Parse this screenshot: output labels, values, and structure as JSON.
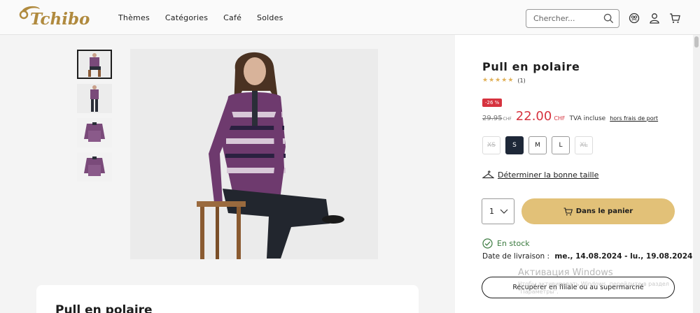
{
  "brand": {
    "name": "Tchibo",
    "color": "#b08a3e"
  },
  "nav": {
    "items": [
      "Thèmes",
      "Catégories",
      "Café",
      "Soldes"
    ]
  },
  "search": {
    "placeholder": "Chercher..."
  },
  "header_icons": [
    "fan-club-icon",
    "account-icon",
    "cart-icon"
  ],
  "gallery": {
    "thumbnails": [
      "thumbnail-1",
      "thumbnail-2",
      "thumbnail-3",
      "thumbnail-4"
    ],
    "active_index": 0
  },
  "product": {
    "title": "Pull en polaire",
    "rating": {
      "stars": 5,
      "count_label": "(1)"
    },
    "discount_badge": "-26 %",
    "old_price": "29.95",
    "old_currency": "CHF",
    "new_price": "22.00",
    "new_currency": "CHF",
    "tva_label": "TVA incluse",
    "shipping_link": "hors frais de port",
    "sizes": [
      {
        "label": "XS",
        "state": "disabled"
      },
      {
        "label": "S",
        "state": "selected"
      },
      {
        "label": "M",
        "state": "available"
      },
      {
        "label": "L",
        "state": "available"
      },
      {
        "label": "XL",
        "state": "disabled"
      }
    ],
    "fit_link": "Déterminer la bonne taille",
    "quantity": "1",
    "add_to_cart": "Dans le panier",
    "stock_status": "En stock",
    "delivery_label": "Date de livraison :",
    "delivery_dates": "me., 14.08.2024 - lu., 19.08.2024",
    "pickup_button": "Récupérer en filiale ou au supermarché"
  },
  "description": {
    "title": "Pull en polaire"
  },
  "os_watermark": {
    "title": "Активация Windows",
    "subtitle": "Чтобы активировать Windows, перейдите в раздел \"Параметры\"."
  },
  "colors": {
    "sale_red": "#d6333f",
    "gold_button": "#e2c178",
    "selected_size": "#1e2838",
    "stock_green": "#3a7a3f"
  }
}
